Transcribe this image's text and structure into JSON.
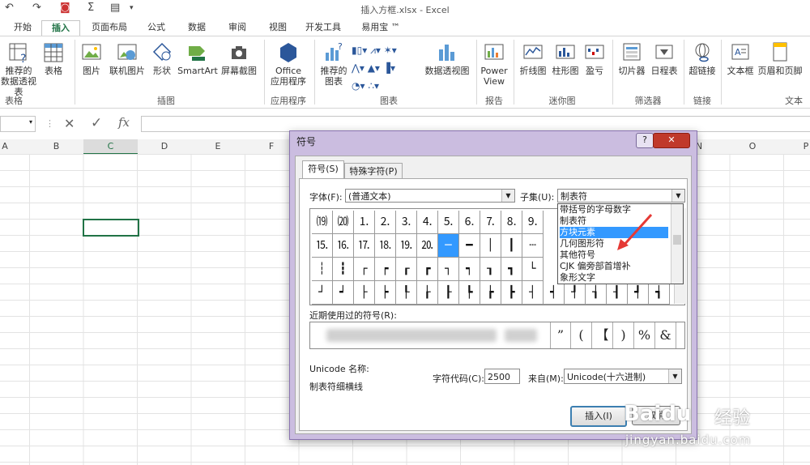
{
  "window": {
    "title": "插入方框.xlsx - Excel"
  },
  "ribbon_tabs": [
    "开始",
    "插入",
    "页面布局",
    "公式",
    "数据",
    "审阅",
    "视图",
    "开发工具",
    "易用宝 ™"
  ],
  "active_tab": "插入",
  "ribbon": {
    "pivot_rec": [
      "推荐的",
      "数据透视表"
    ],
    "table": "表格",
    "picture": "图片",
    "online_pic": "联机图片",
    "shapes": "形状",
    "smartart": "SmartArt",
    "screenshot": "屏幕截图",
    "office_apps": [
      "Office",
      "应用程序"
    ],
    "rec_charts": [
      "推荐的",
      "图表"
    ],
    "pivotchart": "数据透视图",
    "powerview": [
      "Power",
      "View"
    ],
    "line": "折线图",
    "column": "柱形图",
    "winloss": "盈亏",
    "slicer": "切片器",
    "timeline": "日程表",
    "hyperlink": "超链接",
    "textbox": "文本框",
    "header_footer": "页眉和页脚",
    "groups": {
      "tables": "表格",
      "illustrations": "插图",
      "apps": "应用程序",
      "charts": "图表",
      "reports": "报告",
      "sparklines": "迷你图",
      "filters": "筛选器",
      "links": "链接",
      "text": "文本"
    }
  },
  "formula_bar": {
    "cancel": "✕",
    "enter": "✓",
    "fx": "fx"
  },
  "columns": [
    "A",
    "B",
    "C",
    "D",
    "E",
    "F",
    "N",
    "O",
    "P"
  ],
  "dialog": {
    "title": "符号",
    "help": "?",
    "close": "✕",
    "tabs": [
      "符号(S)",
      "特殊字符(P)"
    ],
    "font_label": "字体(F):",
    "font_value": "(普通文本)",
    "subset_label": "子集(U):",
    "subset_value": "制表符",
    "subset_list": [
      "带括号的字母数字",
      "制表符",
      "方块元素",
      "几何图形符",
      "其他符号",
      "CJK 偏旁部首增补",
      "象形文字"
    ],
    "subset_highlight": "方块元素",
    "symbols_row1": [
      "⒆",
      "⒇",
      "⒈",
      "⒉",
      "⒊",
      "⒋",
      "⒌",
      "⒍",
      "⒎",
      "⒏",
      "⒐"
    ],
    "symbols_row2": [
      "⒖",
      "⒗",
      "⒘",
      "⒙",
      "⒚",
      "⒛",
      "─",
      "━",
      "│",
      "┃",
      "┄"
    ],
    "symbols_row3": [
      "┆",
      "┇",
      "┌",
      "┍",
      "┎",
      "┏",
      "┐",
      "┑",
      "┒",
      "┓",
      "└"
    ],
    "symbols_row4": [
      "┘",
      "┙",
      "├",
      "┝",
      "┞",
      "┟",
      "┠",
      "┡",
      "┢",
      "┣",
      "┤",
      "┥",
      "┦",
      "┧",
      "┨",
      "┩",
      "┪"
    ],
    "recent_label": "近期使用过的符号(R):",
    "recent_symbols": [
      "”",
      "(",
      "【",
      ")",
      "%",
      "&"
    ],
    "unicode_name_label": "Unicode 名称:",
    "unicode_name": "制表符细横线",
    "char_code_label": "字符代码(C):",
    "char_code": "2500",
    "from_label": "来自(M):",
    "from_value": "Unicode(十六进制)",
    "insert": "插入(I)",
    "cancel": "取消"
  },
  "watermark": {
    "brand": "Baidu",
    "sub": "经验",
    "url": "jingyan.baidu.com"
  }
}
